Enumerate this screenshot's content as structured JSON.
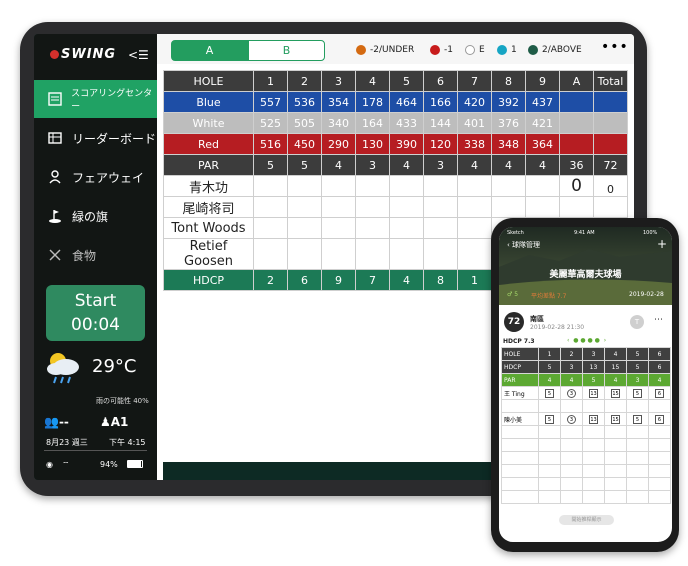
{
  "sidebar": {
    "logo": "SWING",
    "collapse": "<☰",
    "nav": [
      {
        "label": "スコアリングセンター",
        "icon": "scorecard-icon"
      },
      {
        "label": "リーダーボード",
        "icon": "leaderboard-icon"
      },
      {
        "label": "フェアウェイ",
        "icon": "route-icon"
      },
      {
        "label": "緑の旗",
        "icon": "flag-icon"
      },
      {
        "label": "食物",
        "icon": "fork-knife-icon"
      }
    ],
    "start_label": "Start",
    "timer": "00:04",
    "temperature": "29°C",
    "rain_prob": "雨の可能性 40%",
    "players": "--",
    "location": "A1",
    "date": "8月23 週三",
    "time": "下午 4:15",
    "battery": "94%"
  },
  "main": {
    "tabs": [
      "A",
      "B"
    ],
    "legend": [
      {
        "label": "-2/UNDER",
        "color": "#d46a11"
      },
      {
        "label": "-1",
        "color": "#c81c1c"
      },
      {
        "label": "E",
        "color": "#ffffff"
      },
      {
        "label": "1",
        "color": "#16a5c4"
      },
      {
        "label": "2/ABOVE",
        "color": "#1f5c47"
      }
    ],
    "more": "•••"
  },
  "scorecard": {
    "header": [
      "HOLE",
      "1",
      "2",
      "3",
      "4",
      "5",
      "6",
      "7",
      "8",
      "9",
      "A",
      "Total"
    ],
    "blue": [
      "Blue",
      "557",
      "536",
      "354",
      "178",
      "464",
      "166",
      "420",
      "392",
      "437",
      "",
      ""
    ],
    "white": [
      "White",
      "525",
      "505",
      "340",
      "164",
      "433",
      "144",
      "401",
      "376",
      "421",
      "",
      ""
    ],
    "red": [
      "Red",
      "516",
      "450",
      "290",
      "130",
      "390",
      "120",
      "338",
      "348",
      "364",
      "",
      ""
    ],
    "par": [
      "PAR",
      "5",
      "5",
      "4",
      "3",
      "4",
      "3",
      "4",
      "4",
      "4",
      "36",
      "72"
    ],
    "players": [
      {
        "name": "青木功",
        "a": "0",
        "total": "0"
      },
      {
        "name": "尾崎将司",
        "a": "",
        "total": ""
      },
      {
        "name": "Tont Woods",
        "a": "",
        "total": ""
      },
      {
        "name": "Retief Goosen",
        "a": "",
        "total": ""
      }
    ],
    "hdcp": [
      "HDCP",
      "2",
      "6",
      "9",
      "7",
      "4",
      "8",
      "1",
      "",
      "",
      "",
      ""
    ]
  },
  "phone": {
    "carrier": "Sketch",
    "clock": "9:41 AM",
    "battery": "100%",
    "back_label": "球隊管理",
    "course": "美麗華高爾夫球場",
    "par_count": "5",
    "avg": "平均差點 7.7",
    "play_date": "2019-02-28",
    "score": "72",
    "area": "南區",
    "area_time": "2019-02-28 21:30",
    "avatar": "T",
    "hdcp": "HDCP 7.3",
    "holes": [
      "1",
      "2",
      "3",
      "4",
      "5",
      "6"
    ],
    "hdcp_row": [
      "5",
      "3",
      "13",
      "15",
      "5",
      "6"
    ],
    "par_row": [
      "4",
      "4",
      "5",
      "4",
      "3",
      "4"
    ],
    "player1": "王 Ting",
    "p1_scores": [
      "5",
      "3",
      "13",
      "15",
      "5",
      "6"
    ],
    "player2": "陳小美",
    "p2_scores": [
      "5",
      "3",
      "13",
      "15",
      "5",
      "6"
    ],
    "bottom_btn": "開始推桿顯示"
  }
}
